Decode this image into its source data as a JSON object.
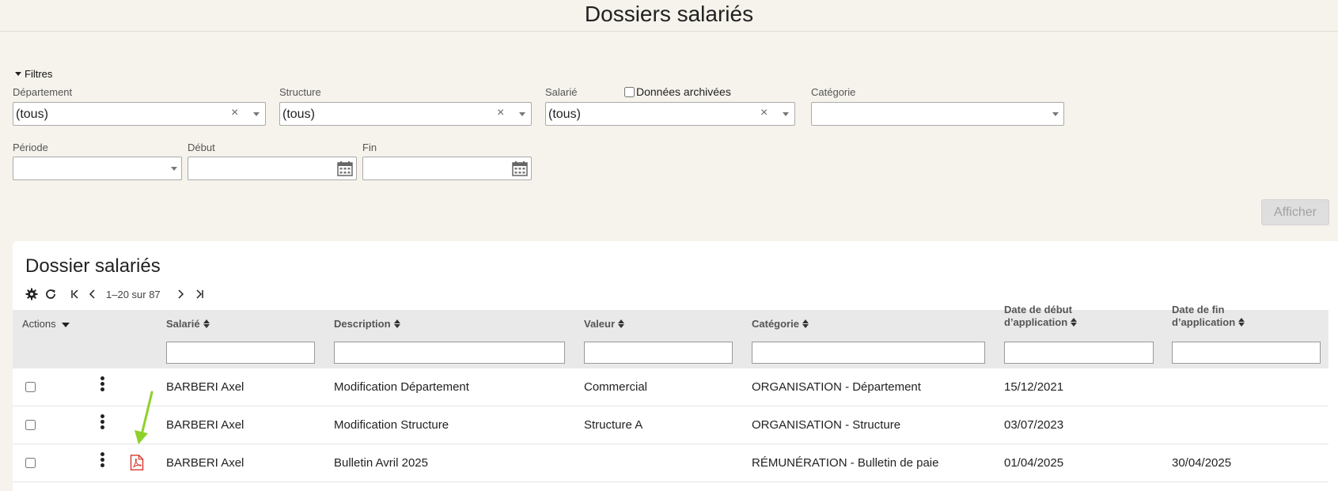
{
  "page_title": "Dossiers salariés",
  "filters": {
    "toggle_label": "Filtres",
    "departement": {
      "label": "Département",
      "value": "(tous)"
    },
    "structure": {
      "label": "Structure",
      "value": "(tous)"
    },
    "salarie": {
      "label": "Salarié",
      "value": "(tous)"
    },
    "archived_label": "Données archivées",
    "categorie": {
      "label": "Catégorie",
      "value": ""
    },
    "periode": {
      "label": "Période",
      "value": ""
    },
    "debut": {
      "label": "Début",
      "value": ""
    },
    "fin": {
      "label": "Fin",
      "value": ""
    },
    "clear_glyph": "×",
    "submit_label": "Afficher"
  },
  "grid": {
    "title": "Dossier salariés",
    "pager_text": "1–20 sur 87",
    "columns": {
      "actions": "Actions",
      "salarie": "Salarié",
      "description": "Description",
      "valeur": "Valeur",
      "categorie": "Catégorie",
      "date_debut_line1": "Date de début",
      "date_debut_line2": "d’application",
      "date_fin_line1": "Date de fin",
      "date_fin_line2": "d’application"
    },
    "rows": [
      {
        "salarie": "BARBERI Axel",
        "description": "Modification Département",
        "valeur": "Commercial",
        "categorie": "ORGANISATION - Département",
        "date_debut": "15/12/2021",
        "date_fin": "",
        "has_pdf": false
      },
      {
        "salarie": "BARBERI Axel",
        "description": "Modification Structure",
        "valeur": "Structure A",
        "categorie": "ORGANISATION - Structure",
        "date_debut": "03/07/2023",
        "date_fin": "",
        "has_pdf": false
      },
      {
        "salarie": "BARBERI Axel",
        "description": "Bulletin Avril 2025",
        "valeur": "",
        "categorie": "RÉMUNÉRATION - Bulletin de paie",
        "date_debut": "01/04/2025",
        "date_fin": "30/04/2025",
        "has_pdf": true
      }
    ]
  },
  "colors": {
    "background": "#f6f3ec",
    "pdf_icon": "#d9342b",
    "annotation_arrow": "#8ed12b",
    "header_bg": "#e9e9e9"
  },
  "icons": [
    "caret-down-icon",
    "calendar-icon",
    "gear-icon",
    "refresh-icon",
    "first-page-icon",
    "prev-page-icon",
    "next-page-icon",
    "last-page-icon",
    "sort-icon",
    "kebab-menu-icon",
    "pdf-icon"
  ]
}
